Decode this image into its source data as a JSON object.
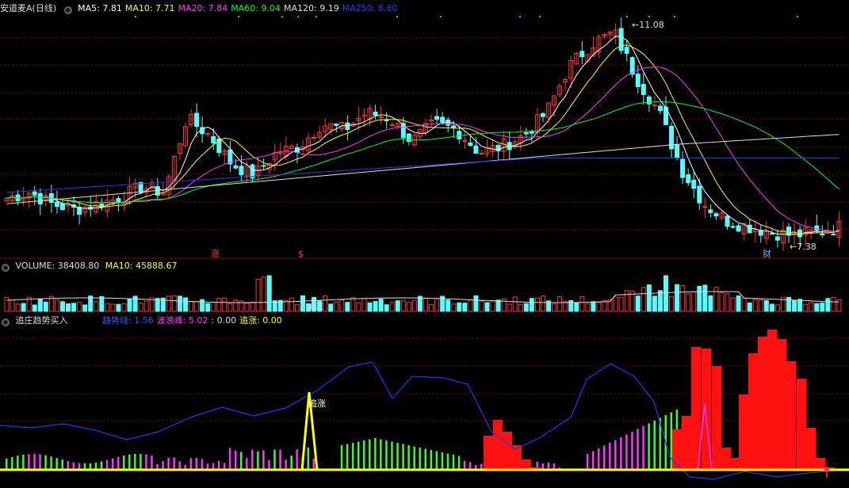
{
  "stock": {
    "name": "安道麦A(日线)"
  },
  "ma_legend": [
    {
      "label": "MA5: 7.81",
      "color": "#ffffff"
    },
    {
      "label": "MA10: 7.71",
      "color": "#ffff00"
    },
    {
      "label": "MA20: 7.84",
      "color": "#ff33ff"
    },
    {
      "label": "MA60: 9.04",
      "color": "#00ff00"
    },
    {
      "label": "MA120: 9.19",
      "color": "#dddddd"
    },
    {
      "label": "MA250: 8.80",
      "color": "#3333ff"
    }
  ],
  "price_annotations": {
    "high": "11.08",
    "low": "7.38",
    "markers": [
      "涨",
      "$",
      "财"
    ]
  },
  "volume_header": {
    "title": "VOLUME: 38408.80",
    "ma": "MA10: 45888.67"
  },
  "volume_label": "追涨",
  "indicator_header": {
    "title": "追庄趋势买入",
    "items": [
      {
        "label": "趋势线: 1.56",
        "color": "#3355ff"
      },
      {
        "label": "波浪峰: 5.02",
        "color": "#ff33ff"
      },
      {
        "label": ": 0.00",
        "color": "#dddddd"
      },
      {
        "label": "追涨: 0.00",
        "color": "#ffff00"
      }
    ]
  },
  "indicator_label": "追涨",
  "colors": {
    "up": "#ff3333",
    "down": "#55ffff",
    "grid": "#8a0000",
    "signal": "#ffff00"
  },
  "chart_data": {
    "type": "candlestick",
    "price_range": [
      7.38,
      11.08
    ],
    "price_series_approx": [
      8.1,
      8.2,
      8.0,
      7.9,
      8.0,
      8.1,
      8.3,
      8.2,
      9.5,
      9.2,
      8.7,
      8.5,
      8.9,
      9.0,
      9.4,
      9.3,
      9.6,
      9.5,
      9.1,
      9.4,
      9.3,
      8.9,
      9.0,
      9.2,
      9.6,
      10.4,
      10.8,
      11.0,
      10.2,
      9.6,
      8.6,
      8.0,
      7.7,
      7.6,
      7.5,
      7.45,
      7.5,
      7.6
    ],
    "volume_last": 38408.8,
    "volume_ma10": 45888.67,
    "trend_line": 1.56,
    "wave_peak": 5.02,
    "chase": 0.0
  }
}
